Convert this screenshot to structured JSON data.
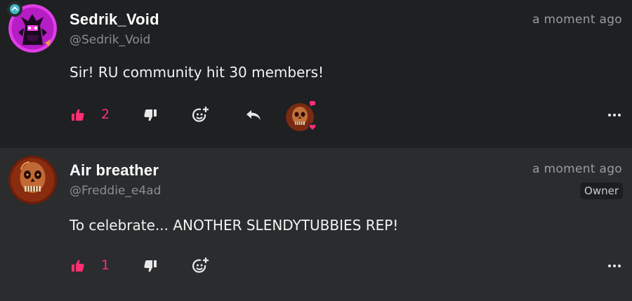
{
  "posts": [
    {
      "display_name": "Sedrik_Void",
      "handle": "@Sedrik_Void",
      "timestamp": "a moment ago",
      "body": "Sir! RU community hit 30 members!",
      "likes": "2",
      "avatar_icon": "magenta-creature-avatar",
      "has_reply": true,
      "has_reactor": true
    },
    {
      "display_name": "Air breather",
      "handle": "@Freddie_e4ad",
      "timestamp": "a moment ago",
      "role": "Owner",
      "body": "To celebrate... ANOTHER SLENDYTUBBIES REP!",
      "likes": "1",
      "avatar_icon": "skull-avatar"
    }
  ],
  "colors": {
    "accent": "#ff2f72",
    "background": "#1e2022",
    "background_alt": "#2a2c2e",
    "text": "#ffffff",
    "muted": "#8a8d90",
    "icon": "#e8e8e8"
  }
}
